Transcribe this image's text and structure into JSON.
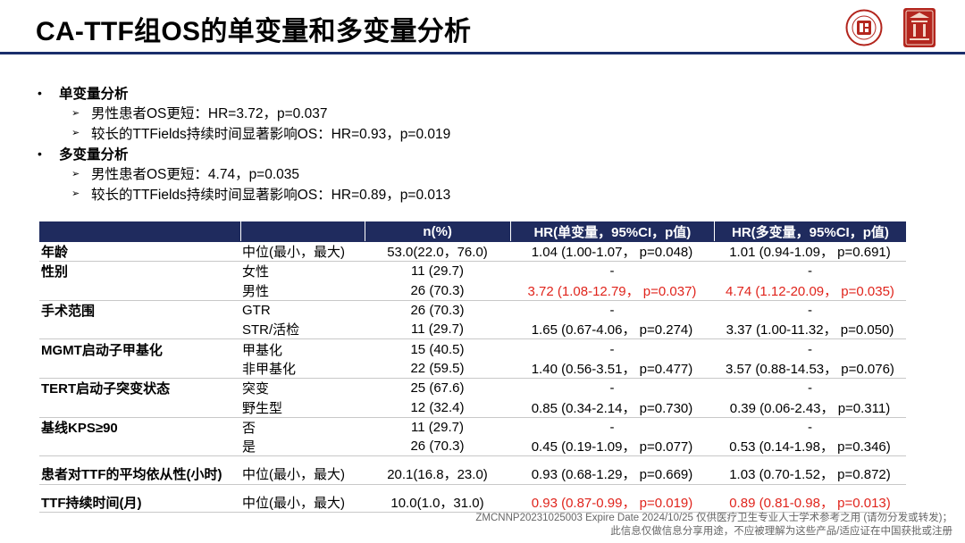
{
  "title": "CA-TTF组OS的单变量和多变量分析",
  "bullets": [
    {
      "label": "单变量分析",
      "items": [
        "男性患者OS更短：HR=3.72，p=0.037",
        "较长的TTFields持续时间显著影响OS：HR=0.93，p=0.019"
      ]
    },
    {
      "label": "多变量分析",
      "items": [
        "男性患者OS更短：4.74，p=0.035",
        "较长的TTFields持续时间显著影响OS：HR=0.89，p=0.013"
      ]
    }
  ],
  "table": {
    "headers": [
      "",
      "",
      "n(%)",
      "HR(单变量，95%CI，p值)",
      "HR(多变量，95%CI，p值)"
    ],
    "groups": [
      {
        "label": "年龄",
        "rows": [
          {
            "sub": "中位(最小，最大)",
            "n": "53.0(22.0，76.0)",
            "uni": "1.04 (1.00-1.07，  p=0.048)",
            "multi": "1.01 (0.94-1.09，  p=0.691)"
          }
        ]
      },
      {
        "label": "性别",
        "rows": [
          {
            "sub": "女性",
            "n": "11 (29.7)",
            "uni": "-",
            "multi": "-"
          },
          {
            "sub": "男性",
            "n": "26 (70.3)",
            "uni": "3.72 (1.08-12.79，  p=0.037)",
            "multi": "4.74 (1.12-20.09，  p=0.035)"
          }
        ]
      },
      {
        "label": "手术范围",
        "rows": [
          {
            "sub": "GTR",
            "n": "26 (70.3)",
            "uni": "-",
            "multi": "-"
          },
          {
            "sub": "STR/活检",
            "n": "11 (29.7)",
            "uni": "1.65 (0.67-4.06，  p=0.274)",
            "multi": "3.37 (1.00-11.32，  p=0.050)"
          }
        ]
      },
      {
        "label": "MGMT启动子甲基化",
        "rows": [
          {
            "sub": "甲基化",
            "n": "15 (40.5)",
            "uni": "-",
            "multi": "-"
          },
          {
            "sub": "非甲基化",
            "n": "22 (59.5)",
            "uni": "1.40 (0.56-3.51，  p=0.477)",
            "multi": "3.57 (0.88-14.53，  p=0.076)"
          }
        ]
      },
      {
        "label": "TERT启动子突变状态",
        "rows": [
          {
            "sub": "突变",
            "n": "25 (67.6)",
            "uni": "-",
            "multi": "-"
          },
          {
            "sub": "野生型",
            "n": "12 (32.4)",
            "uni": "0.85 (0.34-2.14，  p=0.730)",
            "multi": "0.39 (0.06-2.43，  p=0.311)"
          }
        ]
      },
      {
        "label": "基线KPS≥90",
        "rows": [
          {
            "sub": "否",
            "n": "11 (29.7)",
            "uni": "-",
            "multi": "-"
          },
          {
            "sub": "是",
            "n": "26 (70.3)",
            "uni": "0.45 (0.19-1.09，  p=0.077)",
            "multi": "0.53 (0.14-1.98，  p=0.346)"
          }
        ]
      },
      {
        "label": "患者对TTF的平均依从性(小时)",
        "spaced": true,
        "rows": [
          {
            "sub": "中位(最小，最大)",
            "n": "20.1(16.8，23.0)",
            "uni": "0.93 (0.68-1.29，  p=0.669)",
            "multi": "1.03 (0.70-1.52，  p=0.872)"
          }
        ]
      },
      {
        "label": "TTF持续时间(月)",
        "spaced": true,
        "rows": [
          {
            "sub": "中位(最小，最大)",
            "n": "10.0(1.0，31.0)",
            "uni": "0.93 (0.87-0.99，  p=0.019)",
            "multi": "0.89 (0.81-0.98，  p=0.013)"
          }
        ]
      }
    ],
    "highlight_color": "#e0241c"
  },
  "footer": {
    "line1": "ZMCNNP20231025003 Expire Date 2024/10/25 仅供医疗卫生专业人士学术参考之用 (请勿分发或转发)；",
    "line2": "此信息仅做信息分享用途，不应被理解为这些产品/适应证在中国获批或注册"
  },
  "colors": {
    "header_bg": "#1f2b5e",
    "rule": "#1a2e6b",
    "logo_red": "#b3261e"
  }
}
